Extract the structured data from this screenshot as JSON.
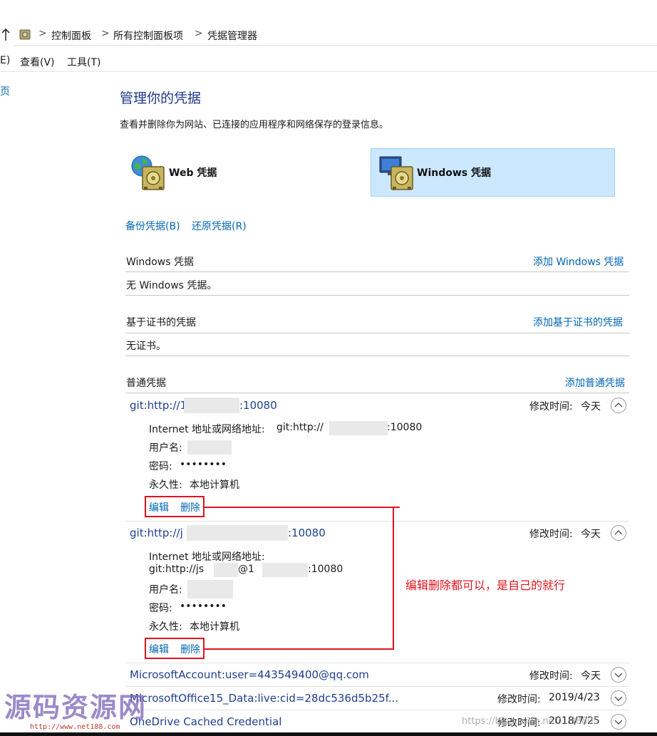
{
  "address": {
    "crumbs": [
      "控制面板",
      "所有控制面板项",
      "凭据管理器"
    ],
    "separator": ">"
  },
  "menu": [
    "E)",
    "查看(V)",
    "工具(T)"
  ],
  "sidebar_fragment": "页",
  "page": {
    "title": "管理你的凭据",
    "description": "查看并删除你为网站、已连接的应用程序和网络保存的登录信息。"
  },
  "vaults": [
    {
      "label": "Web 凭据",
      "icon": "web-credentials-icon",
      "selected": false
    },
    {
      "label": "Windows 凭据",
      "icon": "windows-credentials-icon",
      "selected": true
    }
  ],
  "actions": {
    "backup": "备份凭据(B)",
    "restore": "还原凭据(R)"
  },
  "sections": {
    "windows": {
      "title": "Windows 凭据",
      "add_link": "添加 Windows 凭据",
      "empty_text": "无 Windows 凭据。"
    },
    "certificate": {
      "title": "基于证书的凭据",
      "add_link": "添加基于证书的凭据",
      "empty_text": "无证书。"
    },
    "generic": {
      "title": "普通凭据",
      "add_link": "添加普通凭据"
    }
  },
  "credentials": [
    {
      "name": "git:http://1",
      "name_suffix": ":10080",
      "modified_label": "修改时间:",
      "modified": "今天",
      "expanded": true,
      "details": {
        "address_label": "Internet 地址或网络地址:",
        "address_prefix": "git:http://",
        "address_suffix": ":10080",
        "username_label": "用户名:",
        "password_label": "密码:",
        "password": "••••••••",
        "persistence_label": "永久性:",
        "persistence": "本地计算机"
      },
      "edit": "编辑",
      "delete": "删除"
    },
    {
      "name": "git:http://j",
      "name_suffix": ":10080",
      "modified_label": "修改时间:",
      "modified": "今天",
      "expanded": true,
      "details": {
        "address_label": "Internet 地址或网络地址:",
        "address_prefix": "git:http://js",
        "address_mid": "@1",
        "address_suffix": ":10080",
        "username_label": "用户名:",
        "password_label": "密码:",
        "password": "••••••••",
        "persistence_label": "永久性:",
        "persistence": "本地计算机"
      },
      "edit": "编辑",
      "delete": "删除"
    },
    {
      "name": "MicrosoftAccount:user=443549400@qq.com",
      "modified_label": "修改时间:",
      "modified": "今天",
      "expanded": false
    },
    {
      "name": "MicrosoftOffice15_Data:live:cid=28dc536d5b25f...",
      "modified_label": "修改时间:",
      "modified": "2019/4/23",
      "expanded": false
    },
    {
      "name": "OneDrive Cached Credential",
      "modified_label": "修改时间:",
      "modified": "2018/7/25",
      "expanded": false
    }
  ],
  "annotation": {
    "text": "编辑删除都可以，是自己的就行",
    "color": "#e0141e"
  },
  "watermark": {
    "text": "源码资源网",
    "url": "http://www.net188.com",
    "right": "https://blog.csdn.net/...38805"
  },
  "colors": {
    "link": "#0066b4",
    "selected_tile": "#cce8ff",
    "annotation_red": "#e0141e",
    "title": "#1e3a8a"
  }
}
